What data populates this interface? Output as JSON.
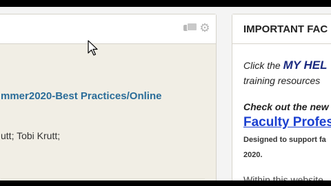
{
  "main_panel": {
    "course_title": "mmer2020-Best Practices/Online",
    "instructors": "utt;  Tobi Krutt;",
    "icons": [
      "discussion-icon",
      "gear-icon"
    ]
  },
  "sidebar_panel": {
    "title": "IMPORTANT FAC",
    "click_prefix": "Click the ",
    "click_highlight": "MY HEL",
    "training_text": "training resources",
    "checkout_text": "Check out the new",
    "faculty_link": "Faculty Profes",
    "designed_text": "Designed to support fa",
    "year_text": "2020.",
    "within_text": "Within this website"
  },
  "colors": {
    "link_blue": "#2b6d99",
    "highlight_navy": "#1b2a80",
    "hyperlink": "#1a3fd0"
  }
}
